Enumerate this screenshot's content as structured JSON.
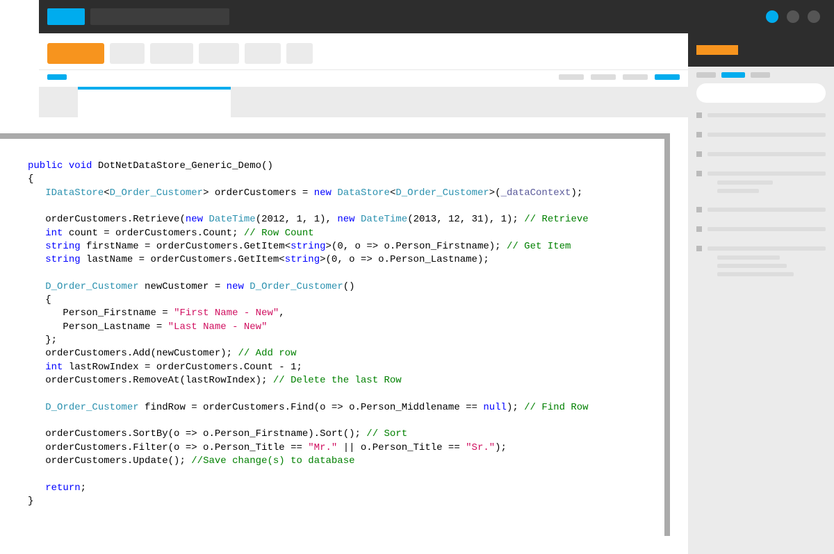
{
  "code": {
    "signature": "public void DotNetDataStore_Generic_Demo()",
    "kw_public": "public",
    "kw_void": "void",
    "method_name": "DotNetDataStore_Generic_Demo",
    "iface": "IDataStore",
    "tparam": "D_Order_Customer",
    "var_orderCustomers": "orderCustomers",
    "kw_new": "new",
    "cls_DataStore": "DataStore",
    "ctx": "_dataContext",
    "retrieve_call": "orderCustomers.Retrieve(",
    "cls_DateTime": "DateTime",
    "dt1_args": "(2012, 1, 1)",
    "dt2_args": "(2013, 12, 31)",
    "retrieve_tail": ", 1);",
    "cmt_retrieve": "// Retrieve",
    "kw_int": "int",
    "count_line": " count = orderCustomers.Count; ",
    "cmt_rowcount": "// Row Count",
    "kw_string": "string",
    "first_name_line": " firstName = orderCustomers.GetItem<",
    "getitem_t": "string",
    "first_tail": ">(0, o => o.Person_Firstname); ",
    "cmt_getitem": "// Get Item",
    "last_name_line": " lastName = orderCustomers.GetItem<",
    "last_tail": ">(0, o => o.Person_Lastname);",
    "newcust_decl": " newCustomer = ",
    "newcust_ctor": "()",
    "prop_fn": "Person_Firstname = ",
    "str_fn": "\"First Name - New\"",
    "prop_ln": "Person_Lastname = ",
    "str_ln": "\"Last Name - New\"",
    "add_line": "orderCustomers.Add(newCustomer); ",
    "cmt_add": "// Add row",
    "lastidx_line": " lastRowIndex = orderCustomers.Count - 1;",
    "remove_line": "orderCustomers.RemoveAt(lastRowIndex); ",
    "cmt_delete": "// Delete the last Row",
    "findrow_decl": " findRow = orderCustomers.Find(o => o.Person_Middlename == ",
    "kw_null": "null",
    "find_tail": "); ",
    "cmt_find": "// Find Row",
    "sort_line": "orderCustomers.SortBy(o => o.Person_Firstname).Sort(); ",
    "cmt_sort": "// Sort",
    "filter_head": "orderCustomers.Filter(o => o.Person_Title == ",
    "str_mr": "\"Mr.\"",
    "filter_mid": " || o.Person_Title == ",
    "str_sr": "\"Sr.\"",
    "filter_tail": ");",
    "update_line": "orderCustomers.Update(); ",
    "cmt_save": "//Save change(s) to database",
    "kw_return": "return"
  }
}
